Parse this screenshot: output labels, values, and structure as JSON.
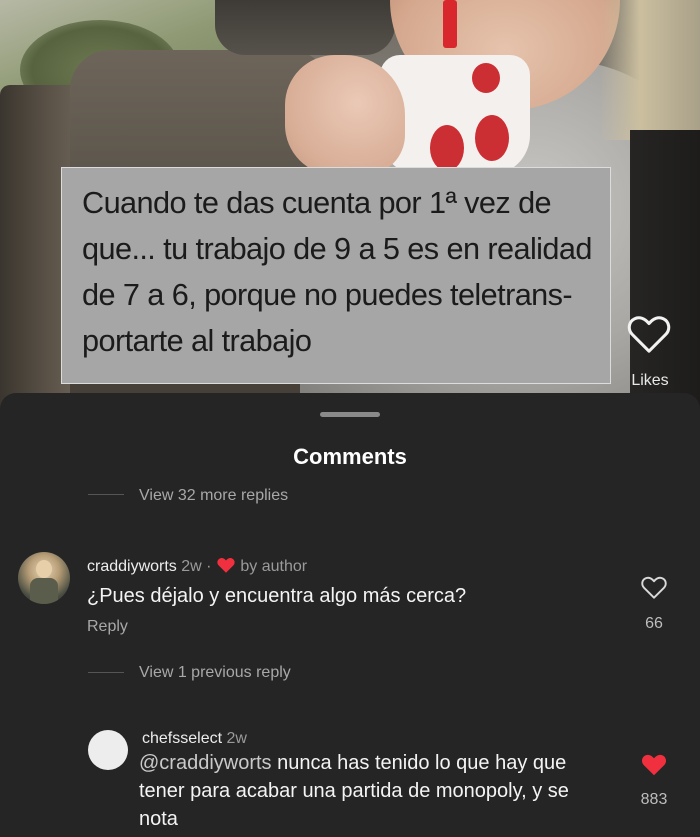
{
  "video": {
    "caption": "Cuando te das cuenta por 1ª vez de que... tu trabajo de 9 a 5 es en realidad de 7 a 6, porque no puedes teletransportarte al trabajo",
    "caption_lines": [
      "Cuando te das cuenta por 1ª vez de",
      "que... tu trabajo de 9 a 5 es en realidad",
      "de 7 a 6, porque no puedes teletrans-",
      "portarte al trabajo"
    ],
    "likes_label": "Likes",
    "like_icon": "heart-outline-icon"
  },
  "comments_sheet": {
    "title": "Comments",
    "view_more_replies": "View 32 more replies",
    "comments": [
      {
        "username": "craddiyworts",
        "age": "2w",
        "separator": "·",
        "author_badge_icon": "heart-filled-icon",
        "author_badge_label": "by author",
        "text": "¿Pues déjalo y encuentra algo más cerca?",
        "reply_label": "Reply",
        "like_icon": "heart-outline-icon",
        "like_count": "66"
      }
    ],
    "view_previous_reply": "View 1 previous reply",
    "replies": [
      {
        "username": "chefsselect",
        "age": "2w",
        "mention": "@craddiyworts",
        "text": "nunca has tenido lo que hay que tener para acabar una partida de monopoly, y se nota",
        "text_lines": [
          "nunca has tenido lo que hay que",
          "tener para acabar una partida de monopoly, y se",
          "nota"
        ],
        "like_icon": "heart-filled-icon",
        "like_count": "883"
      }
    ]
  },
  "colors": {
    "sheet_background": "#252525",
    "caption_background": "#a6a6a6",
    "heart_red": "#f0303e",
    "secondary_text": "#a8a8a8"
  }
}
